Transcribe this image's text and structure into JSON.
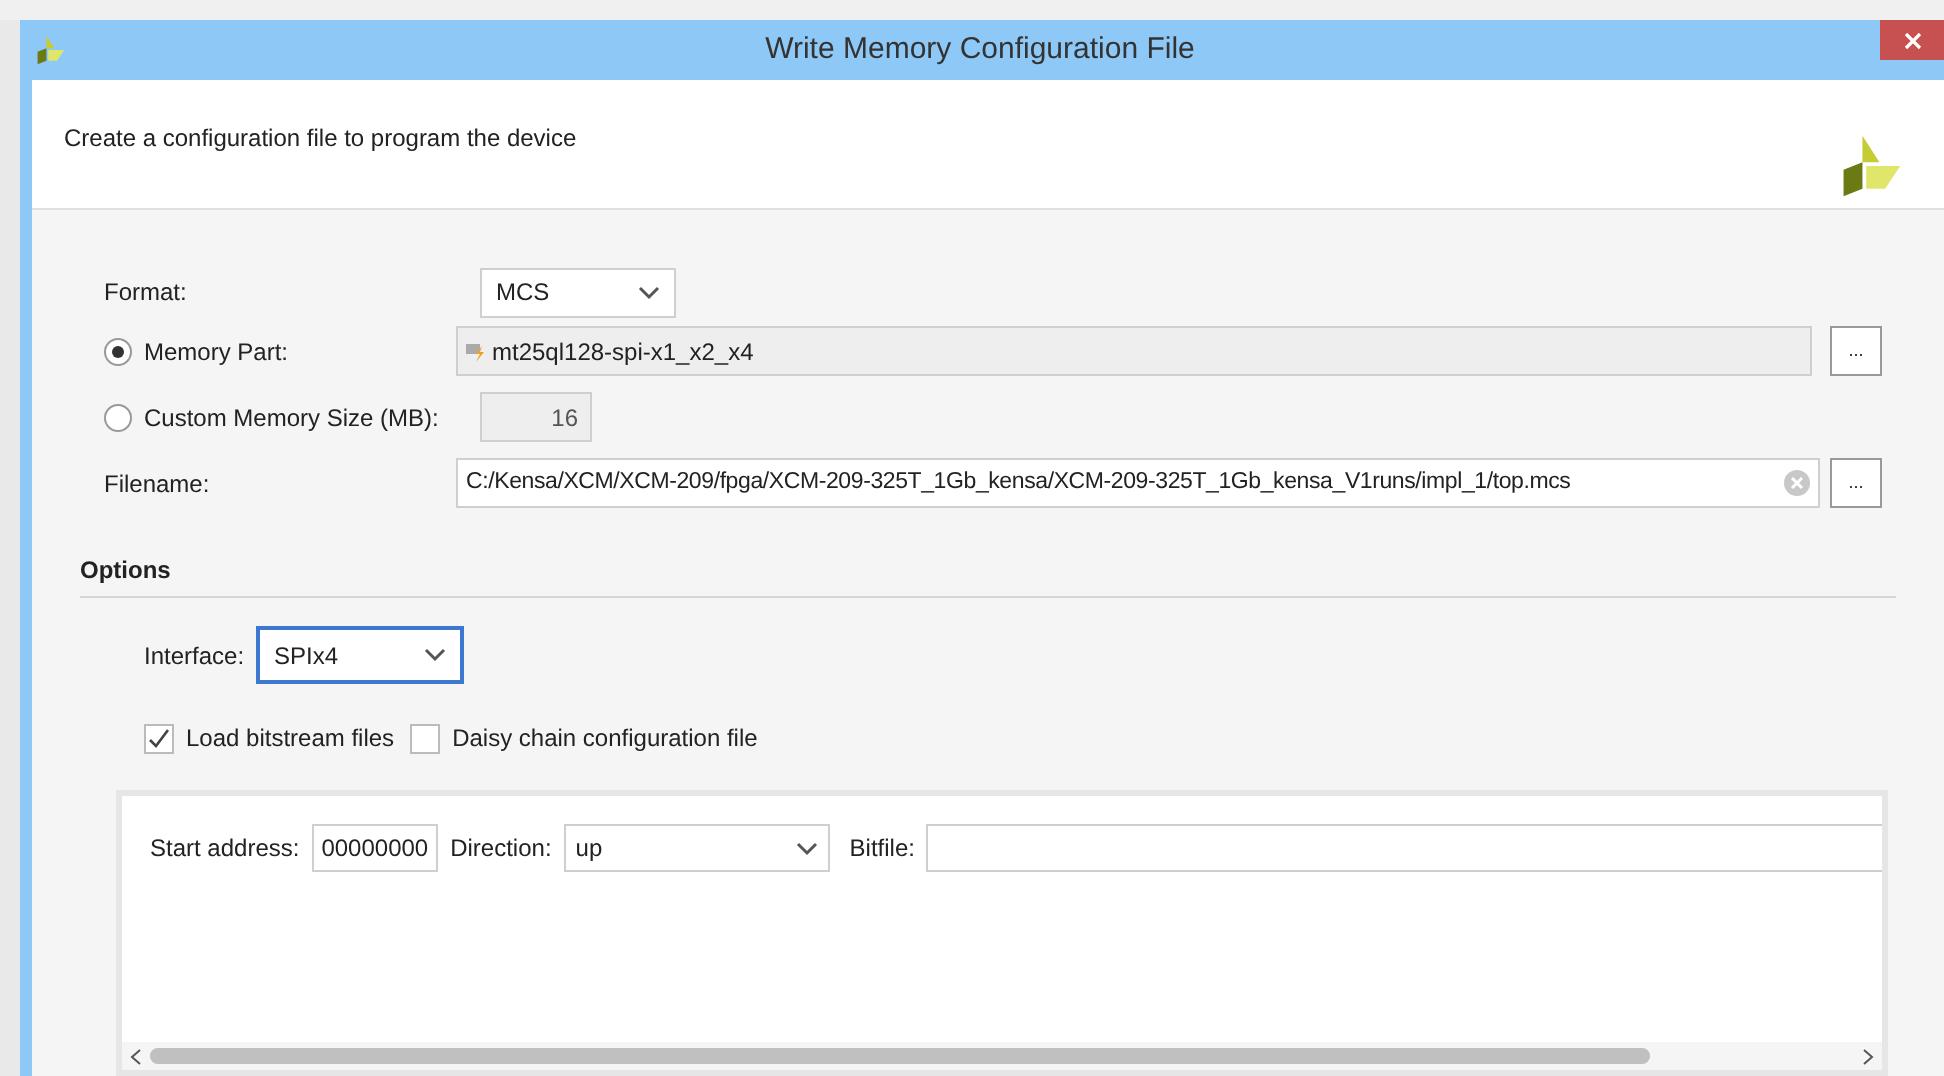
{
  "window": {
    "title": "Write Memory Configuration File"
  },
  "header": {
    "description": "Create a configuration file to program the device"
  },
  "form": {
    "format": {
      "label": "Format:",
      "value": "MCS"
    },
    "memory_options": [
      {
        "kind": "part",
        "label": "Memory Part:",
        "selected": true,
        "value": "mt25ql128-spi-x1_x2_x4"
      },
      {
        "kind": "size",
        "label": "Custom Memory Size (MB):",
        "selected": false,
        "value": "16"
      }
    ],
    "filename": {
      "label": "Filename:",
      "value": "C:/Kensa/XCM/XCM-209/fpga/XCM-209-325T_1Gb_kensa/XCM-209-325T_1Gb_kensa_V1runs/impl_1/top.mcs"
    },
    "browse_buttons": [
      "...",
      "..."
    ]
  },
  "options": {
    "title": "Options",
    "interface": {
      "label": "Interface:",
      "value": "SPIx4"
    },
    "checkboxes": [
      {
        "label": "Load bitstream files",
        "checked": true
      },
      {
        "label": "Daisy chain configuration file",
        "checked": false
      }
    ],
    "bitstream_row": {
      "start_address_label": "Start address:",
      "start_address": "00000000",
      "direction_label": "Direction:",
      "direction": "up",
      "bitfile_label": "Bitfile:"
    }
  }
}
